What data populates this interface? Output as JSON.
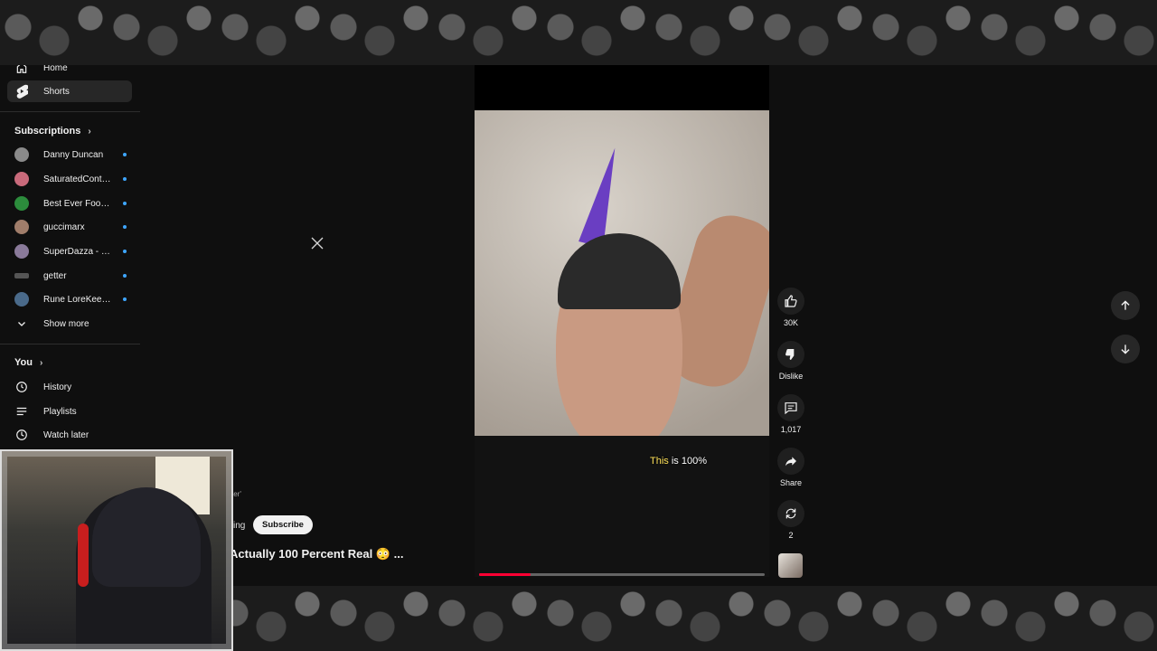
{
  "sidebar": {
    "nav": [
      {
        "label": "Home",
        "icon": "home-icon"
      },
      {
        "label": "Shorts",
        "icon": "shorts-icon",
        "active": true
      }
    ],
    "subscriptions": {
      "heading": "Subscriptions",
      "items": [
        {
          "name": "Danny Duncan",
          "color": "#8a8a8a"
        },
        {
          "name": "SaturatedContent",
          "color": "#c96a7b"
        },
        {
          "name": "Best Ever Food R...",
          "color": "#2c8c3c"
        },
        {
          "name": "guccimarx",
          "color": "#a07d6a"
        },
        {
          "name": "SuperDazza - Be...",
          "color": "#8a7a9a"
        },
        {
          "name": "getter",
          "color": "#555555"
        },
        {
          "name": "Rune LoreKeeper",
          "color": "#4a6a8a"
        }
      ],
      "show_more": "Show more"
    },
    "you": {
      "heading": "You",
      "items": [
        {
          "label": "History",
          "icon": "history-icon"
        },
        {
          "label": "Playlists",
          "icon": "playlists-icon"
        },
        {
          "label": "Watch later",
          "icon": "watch-later-icon"
        }
      ]
    }
  },
  "video": {
    "caption_highlight": "This",
    "caption_rest": " is 100%",
    "progress": 0.18,
    "title": "Actually 100 Percent Real 😳 ...",
    "meta_fragment": "ter'",
    "subscribe_prefix": "ing",
    "subscribe_label": "Subscribe"
  },
  "actions": {
    "like": "30K",
    "dislike": "Dislike",
    "comments": "1,017",
    "share": "Share",
    "remix": "2"
  },
  "colors": {
    "accent": "#ff0033",
    "background": "#0f0f0f",
    "caption_highlight": "#ffe25a",
    "new_dot": "#3ea6ff"
  }
}
